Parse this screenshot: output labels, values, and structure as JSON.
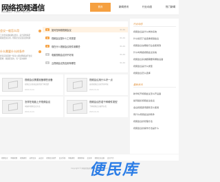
{
  "header": {
    "title": "网络视频通信",
    "subtitle": "网络视频通信 · 行业资讯 · 技术百科"
  },
  "nav": {
    "items": [
      {
        "label": "首页",
        "active": true
      },
      {
        "label": "新闻资讯",
        "active": false
      },
      {
        "label": "行业动态",
        "active": false
      },
      {
        "label": "热门新闻",
        "active": false
      }
    ]
  },
  "left_block": {
    "title1": "会议一般怎么用",
    "text1": "工具会议视频通信会议，是合需要满足",
    "text2": "视频会议应用，帮助企业实现高效沟通",
    "title2": "什么需要什么样条件",
    "text3": "会议实际需要一些可以通过网络进行会议",
    "text4": "要求，视频会议的，有一定的效率"
  },
  "news": [
    {
      "badge": "热",
      "title": "如何在网络视频会议",
      "date": "01-01",
      "highlight": true
    },
    {
      "badge": "热",
      "title": "视频会议是什么工作类型",
      "date": "01-01",
      "highlight": false
    },
    {
      "badge": "热",
      "title": "现在什么视频会议软件用哪些",
      "date": "01-01",
      "highlight": false
    },
    {
      "badge": "新",
      "title": "电脑视频会议好不好用",
      "date": "01-01",
      "highlight": false
    },
    {
      "badge": "新",
      "title": "云视频会议的应用有哪些",
      "date": "01-01",
      "highlight": false
    }
  ],
  "sidebar": {
    "heading1": "行业动态",
    "items1": [
      "视频会议是什么样的系统",
      "什么情况下会选择视频会议",
      "视频会议在哪些行业会使用到",
      "什么叫网络视频会议系统",
      "视频会议系统都需要有哪些设备",
      "视频会议是什么类型",
      "视频会议怎么选择"
    ],
    "heading2": "最新资讯",
    "items2": [
      "新华机开视频会议怎么开设备",
      "如何组织视频会议会议",
      "会议视频通讯服务怎么使用",
      "有什么视频会议的软件",
      "视频会议的管理方法",
      "视频会议的操作方法是什么"
    ]
  },
  "cards": [
    {
      "title": "视频会议需要准备哪些设备",
      "desc": "视频会议准备设备需要了解清楚",
      "meta": "2020-01-01"
    },
    {
      "title": "视频会议用什么好一点",
      "desc": "选择视频会议软件的时候",
      "meta": "2020-01-01"
    },
    {
      "title": "怎样在电脑上开视频会议",
      "desc": "电脑开视频会议方法",
      "meta": "2020-01-01"
    },
    {
      "title": "视频会议的若干种硬件类型",
      "desc": "了解视频会议硬件分类",
      "meta": "2020-01-01"
    }
  ],
  "footer": {
    "links": [
      "视频会议",
      "网络视频",
      "视频通话",
      "远程会议",
      "云会议",
      "视频会议软件",
      "会议系统",
      "网络通信",
      "视频终端",
      "会议室",
      "视频会议设备",
      "会议平台"
    ],
    "copyright": "Copyright © 网络视频通信 All Rights Reserved"
  },
  "watermark": "便民库",
  "colors": {
    "accent": "#f5a040",
    "watermark": "#2c7de6"
  }
}
